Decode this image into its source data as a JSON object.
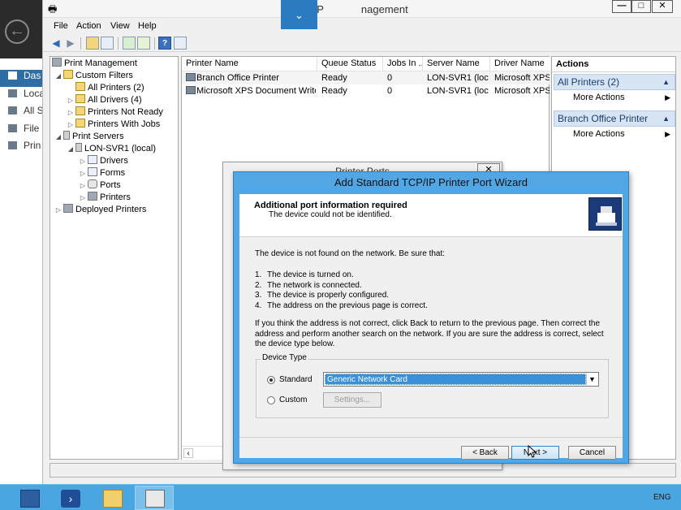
{
  "background_app": {
    "nav": [
      "Das",
      "Loca",
      "All S",
      "File",
      "Prin"
    ]
  },
  "window": {
    "title_left": "P",
    "title_right": "nagement",
    "controls": {
      "minimize": "—",
      "maximize": "□",
      "close": "✕"
    }
  },
  "scroll_tab_icon": "⌄",
  "menu": [
    "File",
    "Action",
    "View",
    "Help"
  ],
  "toolbar_icons": [
    "back-arrow-icon",
    "forward-arrow-icon",
    "up-folder-icon",
    "show-hide-tree-icon",
    "refresh-icon",
    "export-list-icon",
    "help-icon",
    "properties-icon"
  ],
  "tree": {
    "root": "Print Management",
    "custom_filters": "Custom Filters",
    "all_printers": "All Printers (2)",
    "all_drivers": "All Drivers (4)",
    "printers_not_ready": "Printers Not Ready",
    "printers_with_jobs": "Printers With Jobs",
    "print_servers": "Print Servers",
    "server": "LON-SVR1 (local)",
    "drivers": "Drivers",
    "forms": "Forms",
    "ports": "Ports",
    "printers": "Printers",
    "deployed_printers": "Deployed Printers"
  },
  "list": {
    "columns": [
      "Printer Name",
      "Queue Status",
      "Jobs In ...",
      "Server Name",
      "Driver Name"
    ],
    "rows": [
      {
        "name": "Branch Office Printer",
        "status": "Ready",
        "jobs": "0",
        "server": "LON-SVR1 (loc...",
        "driver": "Microsoft XPS C"
      },
      {
        "name": "Microsoft XPS Document Writer",
        "status": "Ready",
        "jobs": "0",
        "server": "LON-SVR1 (loc...",
        "driver": "Microsoft XPS D"
      }
    ]
  },
  "actions": {
    "title": "Actions",
    "section1": "All Printers (2)",
    "section1_item": "More Actions",
    "section2": "Branch Office Printer",
    "section2_item": "More Actions"
  },
  "printer_ports": {
    "title": "Printer Ports",
    "close": "✕"
  },
  "wizard": {
    "title": "Add Standard TCP/IP Printer Port Wizard",
    "header_title": "Additional port information required",
    "header_subtitle": "The device could not be identified.",
    "intro": "The device is not found on the network.  Be sure that:",
    "items": [
      {
        "n": "1.",
        "text": "The device is turned on."
      },
      {
        "n": "2.",
        "text": "The network is connected."
      },
      {
        "n": "3.",
        "text": "The device is properly configured."
      },
      {
        "n": "4.",
        "text": "The address on the previous page is correct."
      }
    ],
    "paragraph": "If you think the address is not correct, click Back to return to the previous page.  Then correct the address and perform another search on the network.  If you are sure the address is correct, select the device type below.",
    "device_type_label": "Device Type",
    "standard_label": "Standard",
    "custom_label": "Custom",
    "standard_value": "Generic Network Card",
    "settings_label": "Settings...",
    "back_label": "< Back",
    "next_label": "Next >",
    "cancel_label": "Cancel"
  },
  "taskbar": {
    "language": "ENG"
  }
}
